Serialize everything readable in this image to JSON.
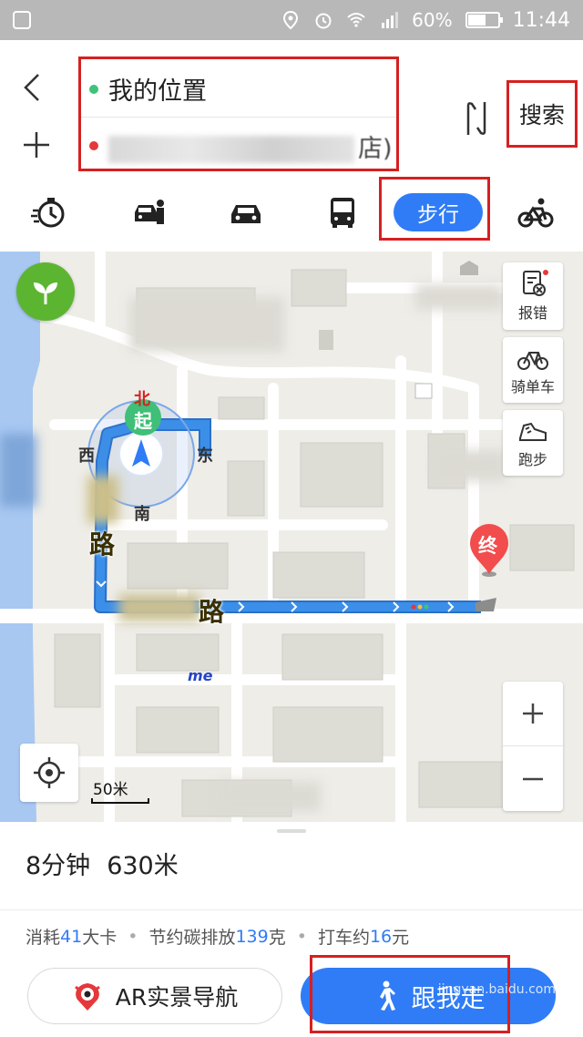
{
  "status_bar": {
    "battery": "60%",
    "time": "11:44",
    "icons": [
      "gallery-icon",
      "location-icon",
      "alarm-icon",
      "wifi-icon",
      "signal-icon",
      "battery-icon"
    ]
  },
  "route": {
    "from": "我的位置",
    "to_visible_suffix": "店)",
    "search_label": "搜索"
  },
  "modes": {
    "items": [
      "taxi-icon",
      "carpool-icon",
      "car-icon",
      "bus-icon",
      "walk",
      "bike-icon"
    ],
    "active_label": "步行"
  },
  "map": {
    "compass": {
      "north": "北",
      "west": "西",
      "east": "东",
      "south": "南",
      "start": "起"
    },
    "road_label_1": "路",
    "road_label_2": "路",
    "end_label": "终",
    "tools": {
      "report": "报错",
      "bike": "骑单车",
      "run": "跑步"
    },
    "scale": "50米",
    "misc_text": "me",
    "accent_color": "#2f7cf6",
    "route_color": "#3b8fe8",
    "leaf_color": "#5cb531"
  },
  "summary": {
    "duration": "8分钟",
    "distance": "630米"
  },
  "stats": {
    "calorie_prefix": "消耗",
    "calorie_value": "41",
    "calorie_suffix": "大卡",
    "carbon_prefix": "节约碳排放",
    "carbon_value": "139",
    "carbon_suffix": "克",
    "taxi_prefix": "打车约",
    "taxi_value": "16",
    "taxi_suffix": "元"
  },
  "buttons": {
    "ar_nav": "AR实景导航",
    "follow_me": "跟我走",
    "watermark": "jingyan.baidu.com"
  }
}
